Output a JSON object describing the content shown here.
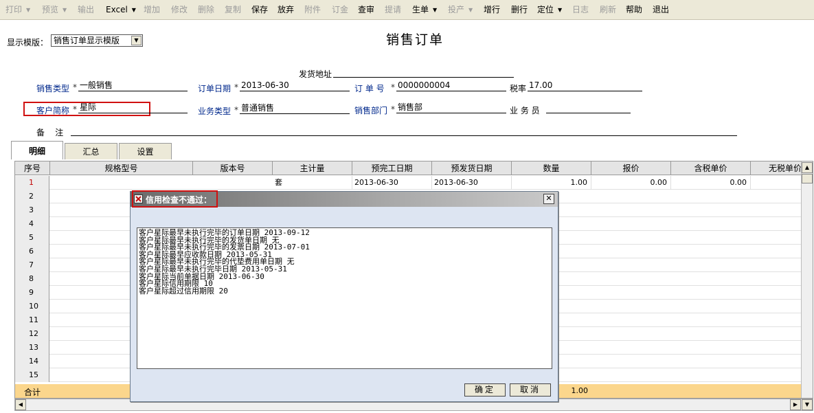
{
  "toolbar": {
    "items": [
      {
        "label": "打印",
        "enabled": false,
        "dropdown": true
      },
      {
        "label": "预览",
        "enabled": false,
        "dropdown": true
      },
      {
        "label": "输出",
        "enabled": false,
        "dropdown": false
      },
      {
        "label": "Excel",
        "enabled": true,
        "dropdown": true
      },
      {
        "label": "增加",
        "enabled": false,
        "dropdown": false
      },
      {
        "label": "修改",
        "enabled": false,
        "dropdown": false
      },
      {
        "label": "删除",
        "enabled": false,
        "dropdown": false
      },
      {
        "label": "复制",
        "enabled": false,
        "dropdown": false
      },
      {
        "label": "保存",
        "enabled": true,
        "dropdown": false
      },
      {
        "label": "放弃",
        "enabled": true,
        "dropdown": false
      },
      {
        "label": "附件",
        "enabled": false,
        "dropdown": false
      },
      {
        "label": "订金",
        "enabled": false,
        "dropdown": false
      },
      {
        "label": "查审",
        "enabled": true,
        "dropdown": false
      },
      {
        "label": "提请",
        "enabled": false,
        "dropdown": false
      },
      {
        "label": "生单",
        "enabled": true,
        "dropdown": true
      },
      {
        "label": "投产",
        "enabled": false,
        "dropdown": true
      },
      {
        "label": "增行",
        "enabled": true,
        "dropdown": false
      },
      {
        "label": "删行",
        "enabled": true,
        "dropdown": false
      },
      {
        "label": "定位",
        "enabled": true,
        "dropdown": true
      },
      {
        "label": "日志",
        "enabled": false,
        "dropdown": false
      },
      {
        "label": "刷新",
        "enabled": false,
        "dropdown": false
      },
      {
        "label": "帮助",
        "enabled": true,
        "dropdown": false
      },
      {
        "label": "退出",
        "enabled": true,
        "dropdown": false
      }
    ]
  },
  "template": {
    "label": "显示模版：",
    "value": "销售订单显示模版"
  },
  "title": "销售订单",
  "header": {
    "ship_address_label": "发货地址",
    "ship_address_value": "",
    "sale_type_label": "销售类型",
    "sale_type_value": "一般销售",
    "order_date_label": "订单日期",
    "order_date_value": "2013-06-30",
    "order_no_label": "订 单 号",
    "order_no_value": "0000000004",
    "tax_label": "税率",
    "tax_value": "17.00",
    "customer_label": "客户简称",
    "customer_value": "星际",
    "biz_type_label": "业务类型",
    "biz_type_value": "普通销售",
    "dept_label": "销售部门",
    "dept_value": "销售部",
    "clerk_label": "业 务 员",
    "clerk_value": "",
    "remark_label": "备    注",
    "remark_value": "",
    "required_mark": "*"
  },
  "tabs": [
    "明细",
    "汇总",
    "设置"
  ],
  "grid": {
    "columns": [
      "序号",
      "规格型号",
      "版本号",
      "主计量",
      "预完工日期",
      "预发货日期",
      "数量",
      "报价",
      "含税单价",
      "无税单价"
    ],
    "rows": [
      {
        "no": "1",
        "unit": "套",
        "finish_date": "2013-06-30",
        "ship_date": "2013-06-30",
        "qty": "1.00",
        "quote": "0.00",
        "tax_price": "0.00"
      },
      {
        "no": "2"
      },
      {
        "no": "3"
      },
      {
        "no": "4"
      },
      {
        "no": "5"
      },
      {
        "no": "6"
      },
      {
        "no": "7"
      },
      {
        "no": "8"
      },
      {
        "no": "9"
      },
      {
        "no": "10"
      },
      {
        "no": "11"
      },
      {
        "no": "12"
      },
      {
        "no": "13"
      },
      {
        "no": "14"
      },
      {
        "no": "15"
      }
    ],
    "total_label": "合计",
    "total_qty": "1.00"
  },
  "dialog": {
    "title": "信用检查不通过：",
    "close_glyph": "✕",
    "messages": [
      "客户星际最早未执行完毕的订单日期 2013-09-12",
      "客户星际最早未执行完毕的发货单日期 无",
      "客户星际最早未执行完毕的发票日期 2013-07-01",
      "客户星际最早应收款日期 2013-05-31",
      "客户星际最早未执行完毕的代垫费用单日期 无",
      "客户星际最早未执行完毕日期 2013-05-31",
      "客户星际当前单据日期 2013-06-30",
      "客户星际信用期限 10",
      "客户星际超过信用期限 20"
    ],
    "ok_label": "确定",
    "cancel_label": "取消"
  },
  "colors": {
    "highlight": "#d01010",
    "total_row": "#fbd68c",
    "label_blue": "#00288c"
  }
}
